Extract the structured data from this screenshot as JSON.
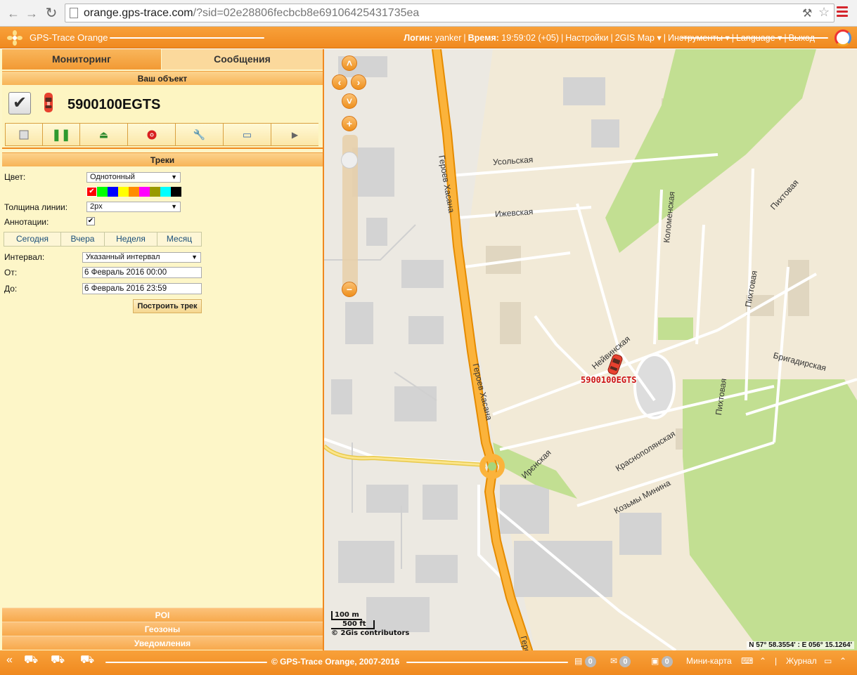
{
  "browser": {
    "url_host": "orange.gps-trace.com",
    "url_path": "/?sid=02e28806fecbcb8e69106425431735ea"
  },
  "header": {
    "app_title": "GPS-Trace Orange",
    "login_label": "Логин:",
    "login_value": "yanker",
    "time_label": "Время:",
    "time_value": "19:59:02 (+05)",
    "links": [
      "Настройки",
      "2GIS Map",
      "Инструменты",
      "Language",
      "Выход"
    ]
  },
  "tabs": {
    "monitoring": "Мониторинг",
    "messages": "Сообщения"
  },
  "object_section": {
    "title": "Ваш объект",
    "object_name": "5900100EGTS"
  },
  "tracks": {
    "title": "Треки",
    "color_label": "Цвет:",
    "color_value": "Однотонный",
    "palette": [
      "#ff0000",
      "#00ff00",
      "#0000ff",
      "#ffff00",
      "#ff8c00",
      "#ff00ff",
      "#999900",
      "#00ffff",
      "#000000"
    ],
    "width_label": "Толщина линии:",
    "width_value": "2px",
    "annotations_label": "Аннотации:",
    "periods": [
      "Сегодня",
      "Вчера",
      "Неделя",
      "Месяц"
    ],
    "interval_label": "Интервал:",
    "interval_value": "Указанный интервал",
    "from_label": "От:",
    "from_value": "6 Февраль 2016 00:00",
    "to_label": "До:",
    "to_value": "6 Февраль 2016 23:59",
    "build_button": "Построить трек"
  },
  "accordion": [
    "POI",
    "Геозоны",
    "Уведомления"
  ],
  "map": {
    "streets": [
      "Героев Хасана",
      "Героев Хасана",
      "Усольская",
      "Ижевская",
      "Коломенская",
      "Пихтовая",
      "Пихтовая",
      "Пихтовая",
      "Бригадирская",
      "Нейвинская",
      "Краснополянская",
      "Ирєнская",
      "Козьмы Минина",
      "Героев Хасана"
    ],
    "object_label": "5900100EGTS",
    "scale_m": "100 m",
    "scale_ft": "500 ft",
    "attribution": "© 2Gis contributors",
    "coords": "N 57° 58.3554' : E 056° 15.1264'"
  },
  "footer": {
    "copyright": "© GPS-Trace Orange, 2007-2016",
    "counter1": "0",
    "counter2": "0",
    "counter3": "0",
    "minimap": "Мини-карта",
    "journal": "Журнал"
  }
}
